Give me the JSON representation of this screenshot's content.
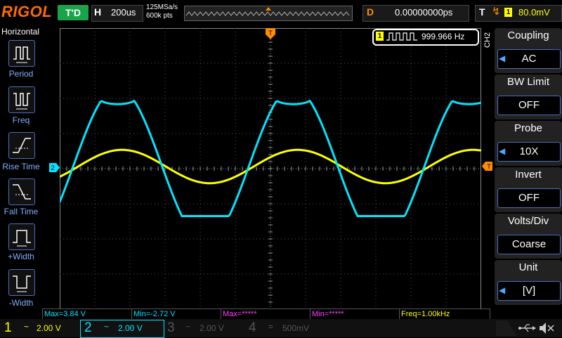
{
  "brand": "RIGOL",
  "header": {
    "trigger_state": "T'D",
    "horizontal_letter": "H",
    "timebase": "200us",
    "sample_rate": "125MSa/s",
    "memory_depth": "600k pts",
    "delay_letter": "D",
    "delay_value": "0.00000000ps",
    "trigger_letter": "T",
    "trigger_source": "1",
    "trigger_level": "80.0mV"
  },
  "left_menu": {
    "title": "Horizontal",
    "items": [
      {
        "label": "Period",
        "icon": "period-icon"
      },
      {
        "label": "Freq",
        "icon": "freq-icon"
      },
      {
        "label": "Rise Time",
        "icon": "rise-time-icon"
      },
      {
        "label": "Fall Time",
        "icon": "fall-time-icon"
      },
      {
        "label": "+Width",
        "icon": "pos-width-icon"
      },
      {
        "label": "-Width",
        "icon": "neg-width-icon"
      }
    ]
  },
  "freq_counter": {
    "channel": "1",
    "value": "999.966 Hz"
  },
  "trace_markers": {
    "ch2": "2",
    "trigger": "T"
  },
  "right_menu": {
    "channel_label": "CH2",
    "items": [
      {
        "title": "Coupling",
        "value": "AC"
      },
      {
        "title": "BW Limit",
        "value": "OFF"
      },
      {
        "title": "Probe",
        "value": "10X"
      },
      {
        "title": "Invert",
        "value": "OFF"
      },
      {
        "title": "Volts/Div",
        "value": "Coarse"
      },
      {
        "title": "Unit",
        "value": "[V]"
      }
    ]
  },
  "measurements": [
    {
      "text": "Max=3.84 V",
      "color": "#00e5ff"
    },
    {
      "text": "Min=-2.72 V",
      "color": "#00e5ff"
    },
    {
      "text": "Max=*****",
      "color": "#ff40ff"
    },
    {
      "text": "Min=*****",
      "color": "#ff40ff"
    },
    {
      "text": "Freq=1.00kHz",
      "color": "#ffff00"
    }
  ],
  "channels": [
    {
      "num": "1",
      "coupling": "~",
      "scale": "2.00 V",
      "color": "#ffff00"
    },
    {
      "num": "2",
      "coupling": "~",
      "scale": "2.00 V",
      "color": "#00e5ff"
    },
    {
      "num": "3",
      "coupling": "~",
      "scale": "2.00 V",
      "color": "#ff40ff"
    },
    {
      "num": "4",
      "coupling": "=",
      "scale": "500mV",
      "color": "#3a7fff"
    }
  ],
  "colors": {
    "ch1": "#ffff00",
    "ch2": "#00e5ff",
    "trigger": "#ff8c00",
    "brand": "#ff6a00",
    "accent_blue": "#4a6fbf"
  },
  "waveforms": {
    "timebase_per_div_us": 200,
    "ch1": {
      "shape": "sine",
      "frequency_hz": 1000,
      "volts_per_div": 2.0
    },
    "ch2": {
      "shape": "clipped-sine",
      "frequency_hz": 1000,
      "volts_per_div": 2.0,
      "max_v": 3.84,
      "min_v": -2.72
    }
  }
}
